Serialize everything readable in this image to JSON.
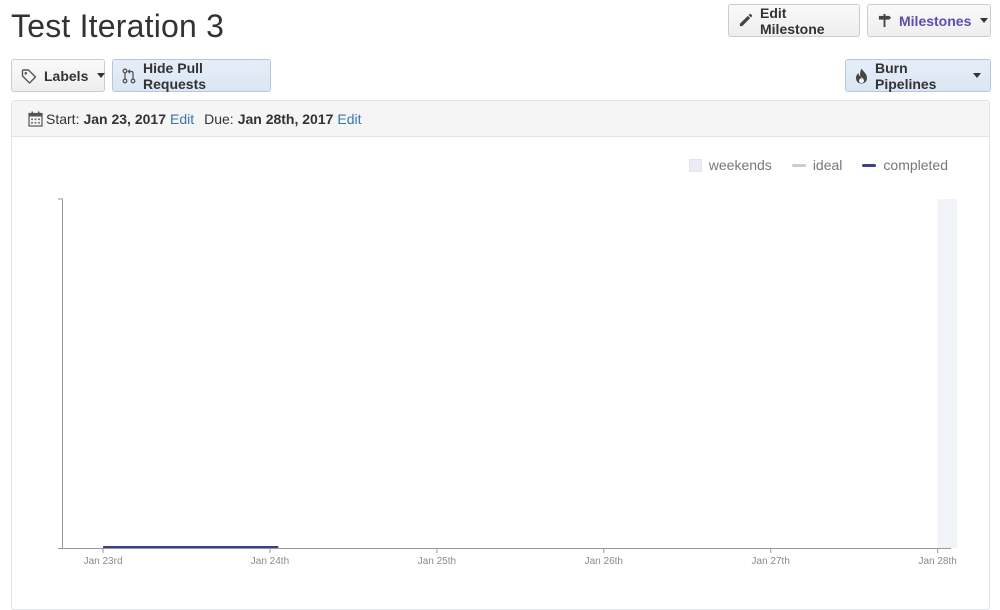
{
  "header": {
    "title": "Test Iteration 3"
  },
  "toolbar": {
    "edit_milestone": "Edit Milestone",
    "milestones": "Milestones",
    "labels": "Labels",
    "hide_pull_requests": "Hide Pull Requests",
    "burn_pipelines": "Burn Pipelines"
  },
  "info_bar": {
    "start_label": "Start:",
    "start_date": "Jan 23, 2017",
    "start_edit": "Edit",
    "due_label": "Due:",
    "due_date": "Jan 28th, 2017",
    "due_edit": "Edit"
  },
  "legend": {
    "weekends": "weekends",
    "ideal": "ideal",
    "completed": "completed"
  },
  "colors": {
    "accent": "#5b4db3",
    "completed": "#3a3f8f",
    "ideal": "#cccccc",
    "weekend": "#ececf7"
  },
  "chart_data": {
    "type": "line",
    "x_ticks": [
      "Jan 23rd",
      "Jan 24th",
      "Jan 25th",
      "Jan 26th",
      "Jan 27th",
      "Jan 28th"
    ],
    "series": [
      {
        "name": "completed",
        "x": [
          23,
          24.05
        ],
        "y": [
          0,
          0
        ]
      },
      {
        "name": "ideal",
        "x": [],
        "y": []
      }
    ],
    "weekend_band": [
      28,
      28.08
    ],
    "xlim": [
      22.76,
      28.08
    ],
    "legend_position": "top-right"
  }
}
